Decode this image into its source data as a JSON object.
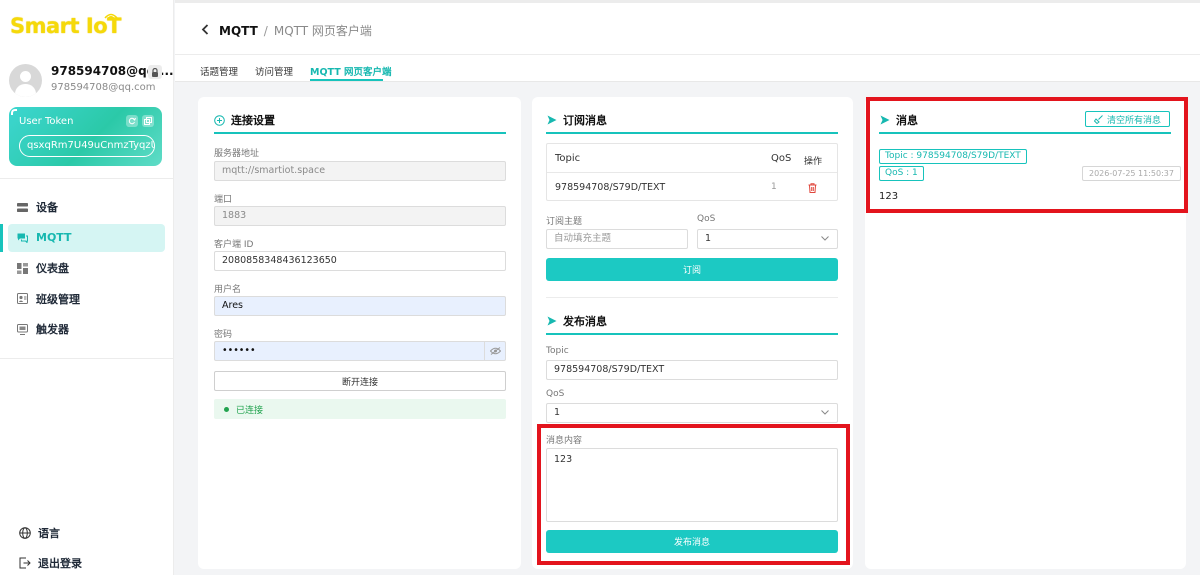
{
  "app": {
    "logo_text": "Smart IoT"
  },
  "profile": {
    "name": "978594708@qq....",
    "email": "978594708@qq.com"
  },
  "token": {
    "title": "User Token",
    "value": "qsxqRm7U49uCnmzTyqzU"
  },
  "sidebar": {
    "items": [
      {
        "label": "设备",
        "icon": "device-icon",
        "active": false
      },
      {
        "label": "MQTT",
        "icon": "mqtt-chat-icon",
        "active": true
      },
      {
        "label": "仪表盘",
        "icon": "dashboard-icon",
        "active": false
      },
      {
        "label": "班级管理",
        "icon": "class-management-icon",
        "active": false
      },
      {
        "label": "触发器",
        "icon": "trigger-icon",
        "active": false
      }
    ],
    "bottom": [
      {
        "label": "语言",
        "icon": "globe-icon"
      },
      {
        "label": "退出登录",
        "icon": "logout-icon"
      }
    ]
  },
  "header": {
    "current": "MQTT",
    "separator": "/",
    "page": "MQTT 网页客户端"
  },
  "tabs": [
    {
      "label": "话题管理",
      "active": false
    },
    {
      "label": "访问管理",
      "active": false
    },
    {
      "label": "MQTT 网页客户端",
      "active": true
    }
  ],
  "connection": {
    "title": "连接设置",
    "server_label": "服务器地址",
    "server_value": "mqtt://smartiot.space",
    "port_label": "端口",
    "port_value": "1883",
    "client_id_label": "客户端 ID",
    "client_id_value": "2080858348436123650",
    "username_label": "用户名",
    "username_value": "Ares",
    "password_label": "密码",
    "password_value": "••••••",
    "disconnect_label": "断开连接",
    "status_label": "已连接"
  },
  "subscribe": {
    "title": "订阅消息",
    "table_headers": {
      "topic": "Topic",
      "qos": "QoS",
      "action": "操作"
    },
    "rows": [
      {
        "topic": "978594708/S79D/TEXT",
        "qos": "1"
      }
    ],
    "topic_label": "订阅主题",
    "topic_placeholder": "自动填充主题",
    "qos_label": "QoS",
    "qos_value": "1",
    "button_label": "订阅"
  },
  "publish": {
    "title": "发布消息",
    "topic_label": "Topic",
    "topic_value": "978594708/S79D/TEXT",
    "qos_label": "QoS",
    "qos_value": "1",
    "content_label": "消息内容",
    "content_value": "123",
    "button_label": "发布消息"
  },
  "messages": {
    "title": "消息",
    "clear_label": "清空所有消息",
    "items": [
      {
        "topic_tag": "Topic : 978594708/S79D/TEXT",
        "qos_tag": "QoS : 1",
        "timestamp": "2026-07-25 11:50:37",
        "content": "123"
      }
    ]
  },
  "colors": {
    "accent": "#17c3bc",
    "highlight": "#e3141d",
    "success": "#22a34f",
    "logo": "#f5d90a"
  }
}
